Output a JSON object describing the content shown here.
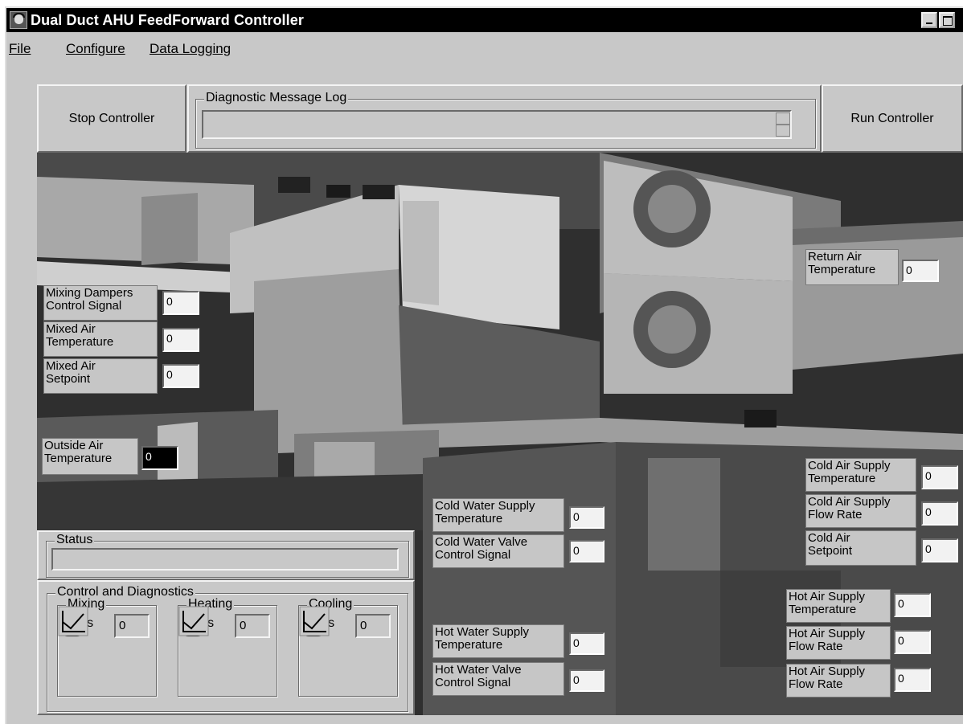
{
  "window": {
    "title": "Dual Duct AHU FeedForward Controller"
  },
  "menubar": {
    "file": "File",
    "configure": "Configure",
    "data_logging": "Data Logging"
  },
  "toolbar": {
    "stop_label": "Stop Controller",
    "run_label": "Run Controller",
    "diag_title": "Diagnostic Message Log",
    "diag_value": ""
  },
  "readings": {
    "return_air_temp": {
      "label": [
        "Return Air",
        "Temperature"
      ],
      "value": "0"
    },
    "mixing_dampers_signal": {
      "label": [
        "Mixing Dampers",
        "Control Signal"
      ],
      "value": "0"
    },
    "mixed_air_temp": {
      "label": [
        "Mixed Air",
        "Temperature"
      ],
      "value": "0"
    },
    "mixed_air_setpoint": {
      "label": [
        "Mixed Air",
        "Setpoint"
      ],
      "value": "0"
    },
    "outside_air_temp": {
      "label": [
        "Outside Air",
        "Temperature"
      ],
      "value": "0"
    },
    "cold_water_supply_temp": {
      "label": [
        "Cold Water Supply",
        "Temperature"
      ],
      "value": "0"
    },
    "cold_water_valve_signal": {
      "label": [
        "Cold Water Valve",
        "Control Signal"
      ],
      "value": "0"
    },
    "hot_water_supply_temp": {
      "label": [
        "Hot Water Supply",
        "Temperature"
      ],
      "value": "0"
    },
    "hot_water_valve_signal": {
      "label": [
        "Hot Water Valve",
        "Control Signal"
      ],
      "value": "0"
    },
    "cold_air_supply_temp": {
      "label": [
        "Cold Air Supply",
        "Temperature"
      ],
      "value": "0"
    },
    "cold_air_supply_flow": {
      "label": [
        "Cold Air Supply",
        "Flow Rate"
      ],
      "value": "0"
    },
    "cold_air_setpoint": {
      "label": [
        "Cold Air",
        "Setpoint"
      ],
      "value": "0"
    },
    "hot_air_supply_temp": {
      "label": [
        "Hot Air Supply",
        "Temperature"
      ],
      "value": "0"
    },
    "hot_air_supply_flow": {
      "label": [
        "Hot Air Supply",
        "Flow Rate"
      ],
      "value": "0"
    },
    "hot_air_supply_flow_2": {
      "label": [
        "Hot Air Supply",
        "Flow Rate"
      ],
      "value": "0"
    }
  },
  "status": {
    "title": "Status",
    "value": ""
  },
  "control": {
    "title": "Control and Diagnostics",
    "groups": [
      {
        "name": "Mixing",
        "bias_label": "Bias",
        "bias_value": "0"
      },
      {
        "name": "Heating",
        "bias_label": "Bias",
        "bias_value": "0"
      },
      {
        "name": "Cooling",
        "bias_label": "Bias",
        "bias_value": "0"
      }
    ]
  },
  "icons": {
    "diagnostics": "medical-kit-icon",
    "trend": "trend-chart-icon",
    "app": "user-face-icon"
  }
}
